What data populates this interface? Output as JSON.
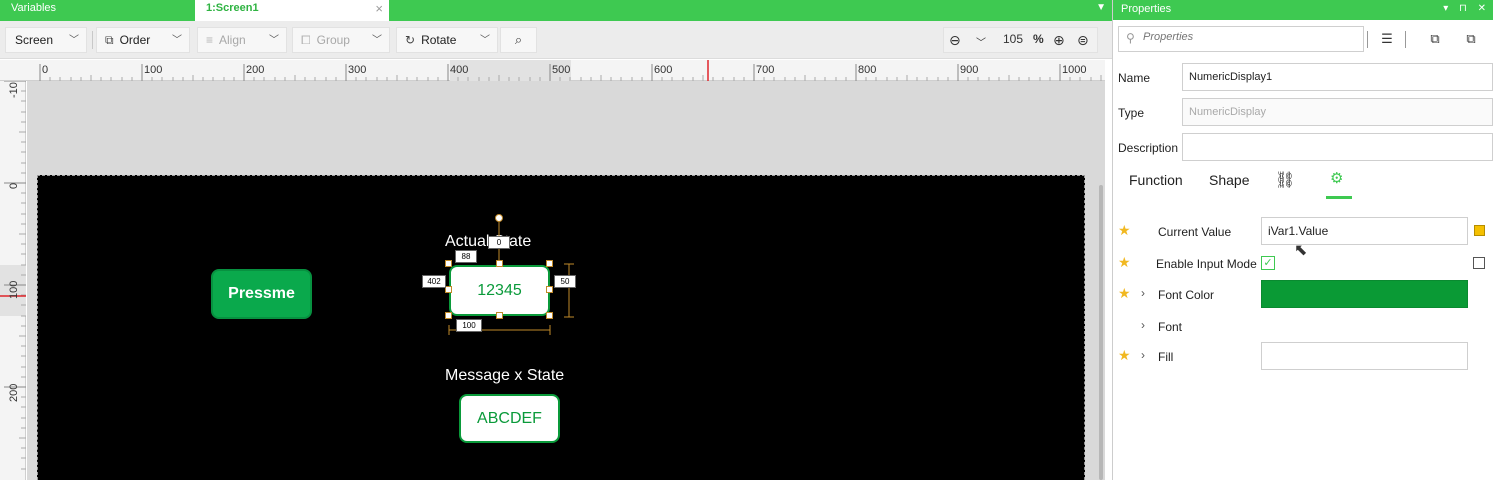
{
  "tabs": {
    "variables": "Variables",
    "screen1": "1:Screen1",
    "close_glyph": "×",
    "overflow_glyph": "▼"
  },
  "toolbar": {
    "screen": "Screen",
    "order": "Order",
    "align": "Align",
    "group": "Group",
    "rotate": "Rotate",
    "zoom_value": "105",
    "zoom_unit": "%"
  },
  "ruler": {
    "top_labels": [
      "0",
      "100",
      "200",
      "300",
      "400",
      "500",
      "600",
      "700",
      "800",
      "900",
      "1000"
    ],
    "left_labels": [
      "-10",
      "0",
      "100",
      "200"
    ]
  },
  "screen_objects": {
    "press_button": "Pressme",
    "actual_state_label": "Actual State",
    "numeric_value": "12345",
    "message_state_label": "Message x State",
    "text_value": "ABCDEF"
  },
  "selection": {
    "rotation": "0",
    "top": "88",
    "left": "402",
    "height": "50",
    "width": "100"
  },
  "properties": {
    "title": "Properties",
    "search_placeholder": "Properties",
    "name_label": "Name",
    "name_value": "NumericDisplay1",
    "type_label": "Type",
    "type_value": "NumericDisplay",
    "description_label": "Description",
    "description_value": "",
    "tab_function": "Function",
    "tab_shape": "Shape",
    "items": {
      "current_value_label": "Current Value",
      "current_value": "iVar1.Value",
      "enable_input_mode_label": "Enable Input Mode",
      "enable_input_mode_checked": "✓",
      "font_color_label": "Font Color",
      "font_color_hex": "#0a9a35",
      "font_label": "Font",
      "fill_label": "Fill",
      "fill_value": ""
    }
  },
  "colors": {
    "accent": "#3ec951",
    "button_green": "#0aa94c",
    "display_green": "#0a9a3a"
  }
}
